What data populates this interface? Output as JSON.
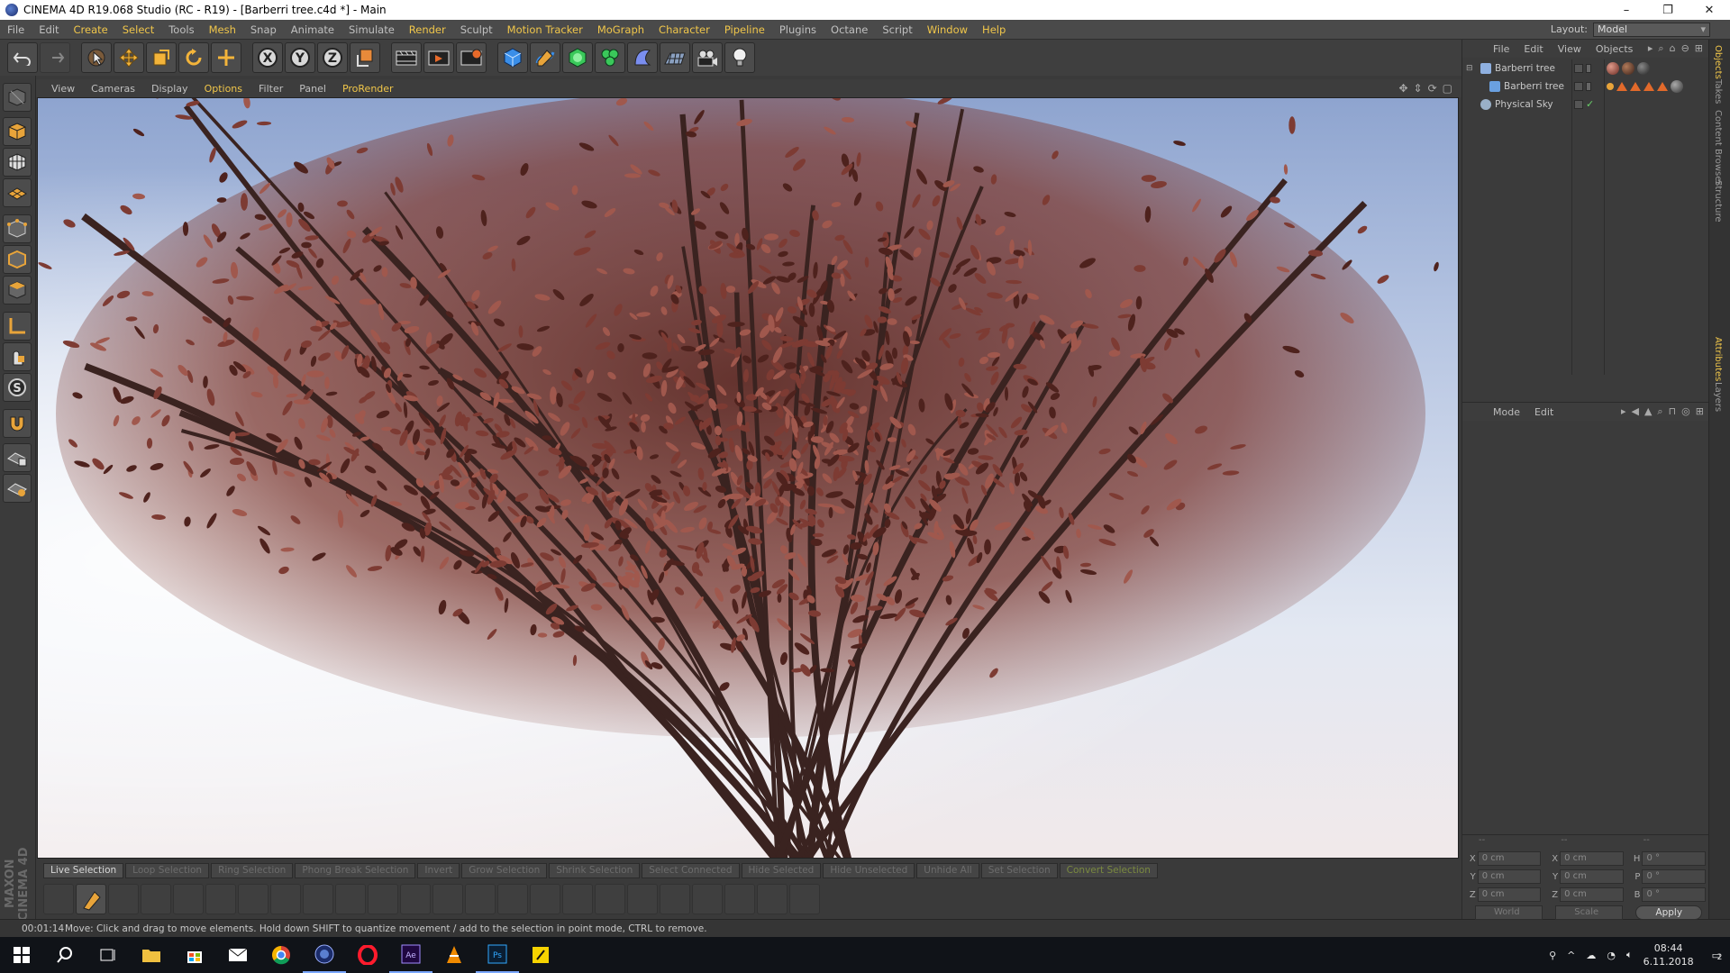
{
  "window": {
    "title": "CINEMA 4D R19.068 Studio (RC - R19) - [Barberri tree.c4d *] - Main",
    "controls": [
      "–",
      "❐",
      "✕"
    ]
  },
  "menu": {
    "items": [
      {
        "label": "File",
        "hl": false
      },
      {
        "label": "Edit",
        "hl": false
      },
      {
        "label": "Create",
        "hl": true
      },
      {
        "label": "Select",
        "hl": true
      },
      {
        "label": "Tools",
        "hl": false
      },
      {
        "label": "Mesh",
        "hl": true
      },
      {
        "label": "Snap",
        "hl": false
      },
      {
        "label": "Animate",
        "hl": false
      },
      {
        "label": "Simulate",
        "hl": false
      },
      {
        "label": "Render",
        "hl": true
      },
      {
        "label": "Sculpt",
        "hl": false
      },
      {
        "label": "Motion Tracker",
        "hl": true
      },
      {
        "label": "MoGraph",
        "hl": true
      },
      {
        "label": "Character",
        "hl": true
      },
      {
        "label": "Pipeline",
        "hl": true
      },
      {
        "label": "Plugins",
        "hl": false
      },
      {
        "label": "Octane",
        "hl": false
      },
      {
        "label": "Script",
        "hl": false
      },
      {
        "label": "Window",
        "hl": true
      },
      {
        "label": "Help",
        "hl": true
      }
    ],
    "layout_label": "Layout:",
    "layout_value": "Model"
  },
  "viewport_menu": {
    "items": [
      {
        "label": "View",
        "hl": false
      },
      {
        "label": "Cameras",
        "hl": false
      },
      {
        "label": "Display",
        "hl": false
      },
      {
        "label": "Options",
        "hl": true
      },
      {
        "label": "Filter",
        "hl": false
      },
      {
        "label": "Panel",
        "hl": false
      },
      {
        "label": "ProRender",
        "hl": true
      }
    ]
  },
  "selection_tools": [
    {
      "label": "Live Selection",
      "state": "active"
    },
    {
      "label": "Loop Selection",
      "state": "disabled"
    },
    {
      "label": "Ring Selection",
      "state": "disabled"
    },
    {
      "label": "Phong Break Selection",
      "state": "disabled"
    },
    {
      "label": "Invert",
      "state": "disabled"
    },
    {
      "label": "Grow Selection",
      "state": "disabled"
    },
    {
      "label": "Shrink Selection",
      "state": "disabled"
    },
    {
      "label": "Select Connected",
      "state": "disabled"
    },
    {
      "label": "Hide Selected",
      "state": "disabled"
    },
    {
      "label": "Hide Unselected",
      "state": "disabled"
    },
    {
      "label": "Unhide All",
      "state": "disabled"
    },
    {
      "label": "Set Selection",
      "state": "disabled"
    },
    {
      "label": "Convert Selection",
      "state": "green"
    }
  ],
  "status": {
    "time": "00:01:14",
    "message": "Move: Click and drag to move elements. Hold down SHIFT to quantize movement / add to the selection in point mode, CTRL to remove."
  },
  "object_manager": {
    "menu": [
      "File",
      "Edit",
      "View",
      "Objects"
    ],
    "objects": [
      {
        "name": "Barberri tree",
        "icon_color": "#8fb0e0"
      },
      {
        "name": "Barberri tree",
        "icon_color": "#6aa0e0"
      },
      {
        "name": "Physical Sky",
        "icon_color": "#9ab0c8"
      }
    ]
  },
  "attributes": {
    "menu": [
      "Mode",
      "Edit"
    ]
  },
  "coordinates": {
    "headers": [
      "--",
      "--",
      "--"
    ],
    "rows": [
      {
        "a": "X",
        "av": "0 cm",
        "b": "X",
        "bv": "0 cm",
        "c": "H",
        "cv": "0 °"
      },
      {
        "a": "Y",
        "av": "0 cm",
        "b": "Y",
        "bv": "0 cm",
        "c": "P",
        "cv": "0 °"
      },
      {
        "a": "Z",
        "av": "0 cm",
        "b": "Z",
        "bv": "0 cm",
        "c": "B",
        "cv": "0 °"
      }
    ],
    "world": "World",
    "scale": "Scale",
    "apply": "Apply"
  },
  "right_tabs": [
    {
      "label": "Objects",
      "on": true
    },
    {
      "label": "Takes",
      "on": false
    },
    {
      "label": "Content Browser",
      "on": false
    },
    {
      "label": "Structure",
      "on": false
    },
    {
      "label": "Attributes",
      "on": true
    },
    {
      "label": "Layers",
      "on": false
    }
  ],
  "branding": "MAXON CINEMA 4D",
  "taskbar": {
    "time": "08:44",
    "date": "6.11.2018",
    "notifications": "2",
    "apps": [
      "start",
      "search",
      "task-view",
      "file-explorer",
      "store",
      "mail",
      "chrome",
      "cinema4d",
      "opera",
      "after-effects",
      "vlc",
      "photoshop",
      "sticky-notes"
    ]
  },
  "colors": {
    "accent": "#f0c64a",
    "foliage": "#7d3b33",
    "bark": "#3a2320"
  }
}
